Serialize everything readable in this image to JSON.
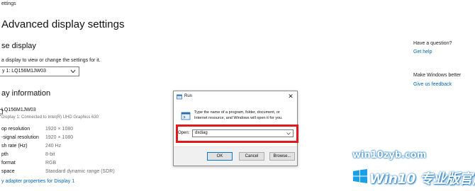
{
  "window": {
    "caption": "ettings"
  },
  "page": {
    "title": "Advanced display settings",
    "choose_display": {
      "heading": "se display",
      "hint": "a display to view or change the settings for it.",
      "selected": "y 1: LQ156M1JW03"
    },
    "display_info": {
      "heading": "ay information",
      "monitor_name": "LQ156M1JW03",
      "monitor_connection": "Display 1: Connected to Intel(R) UHD Graphics 630",
      "rows": [
        {
          "label": "op resolution",
          "value": "1920 × 1080"
        },
        {
          "label": "-signal resolution",
          "value": "1920 × 1080"
        },
        {
          "label": "sh rate (Hz)",
          "value": "240 Hz"
        },
        {
          "label": "pth",
          "value": "8-bit"
        },
        {
          "label": "format",
          "value": "RGB"
        },
        {
          "label": "space",
          "value": "Standard dynamic range (SDR)"
        }
      ],
      "adapter_link": "y adapter properties for Display 1"
    }
  },
  "side": {
    "question": "Have a question?",
    "get_help": "Get help",
    "make_better": "Make Windows better",
    "feedback": "Give us feedback"
  },
  "run_dialog": {
    "title": "Run",
    "description": "Type the name of a program, folder, document, or Internet resource, and Windows will open it for you.",
    "open_label": "Open:",
    "open_value": "dxdiag",
    "ok": "OK",
    "cancel": "Cancel",
    "browse": "Browse...",
    "highlight_color": "#e0191c"
  },
  "watermark": {
    "site": "win10zyb.com",
    "text": "Win10 专业版官网"
  },
  "colors": {
    "link": "#0067b8",
    "accent": "#0078d7"
  }
}
